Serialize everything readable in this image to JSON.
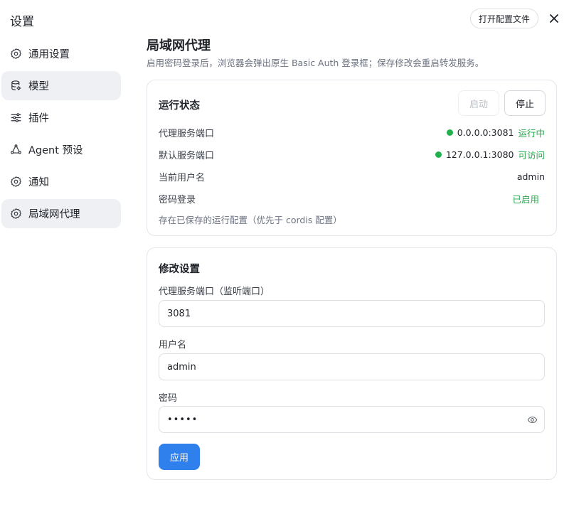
{
  "app": {
    "title": "设置",
    "open_config_label": "打开配置文件"
  },
  "sidebar": {
    "items": [
      {
        "label": "通用设置",
        "icon": "gear-icon"
      },
      {
        "label": "模型",
        "icon": "database-icon"
      },
      {
        "label": "插件",
        "icon": "sliders-icon"
      },
      {
        "label": "Agent 预设",
        "icon": "agent-icon"
      },
      {
        "label": "通知",
        "icon": "gear-icon"
      },
      {
        "label": "局域网代理",
        "icon": "gear-icon"
      }
    ],
    "active": "局域网代理"
  },
  "page": {
    "title": "局域网代理",
    "description": "启用密码登录后，浏览器会弹出原生 Basic Auth 登录框；保存修改会重启转发服务。"
  },
  "status_card": {
    "title": "运行状态",
    "start_label": "启动",
    "stop_label": "停止",
    "rows": [
      {
        "label": "代理服务端口",
        "value": "0.0.0.0:3081",
        "badge": "运行中"
      },
      {
        "label": "默认服务端口",
        "value": "127.0.0.1:3080",
        "badge": "可访问"
      },
      {
        "label": "当前用户名",
        "value": "admin"
      },
      {
        "label": "密码登录",
        "badge": "已启用"
      }
    ],
    "note": "存在已保存的运行配置（优先于 cordis 配置）"
  },
  "settings_card": {
    "title": "修改设置",
    "port_label": "代理服务端口（监听端口）",
    "port_value": "3081",
    "username_label": "用户名",
    "username_value": "admin",
    "password_label": "密码",
    "password_value": "•••••",
    "apply_label": "应用"
  },
  "colors": {
    "accent": "#2f80ed",
    "success": "#21a94a",
    "nav_active_bg": "#eef0f3"
  }
}
